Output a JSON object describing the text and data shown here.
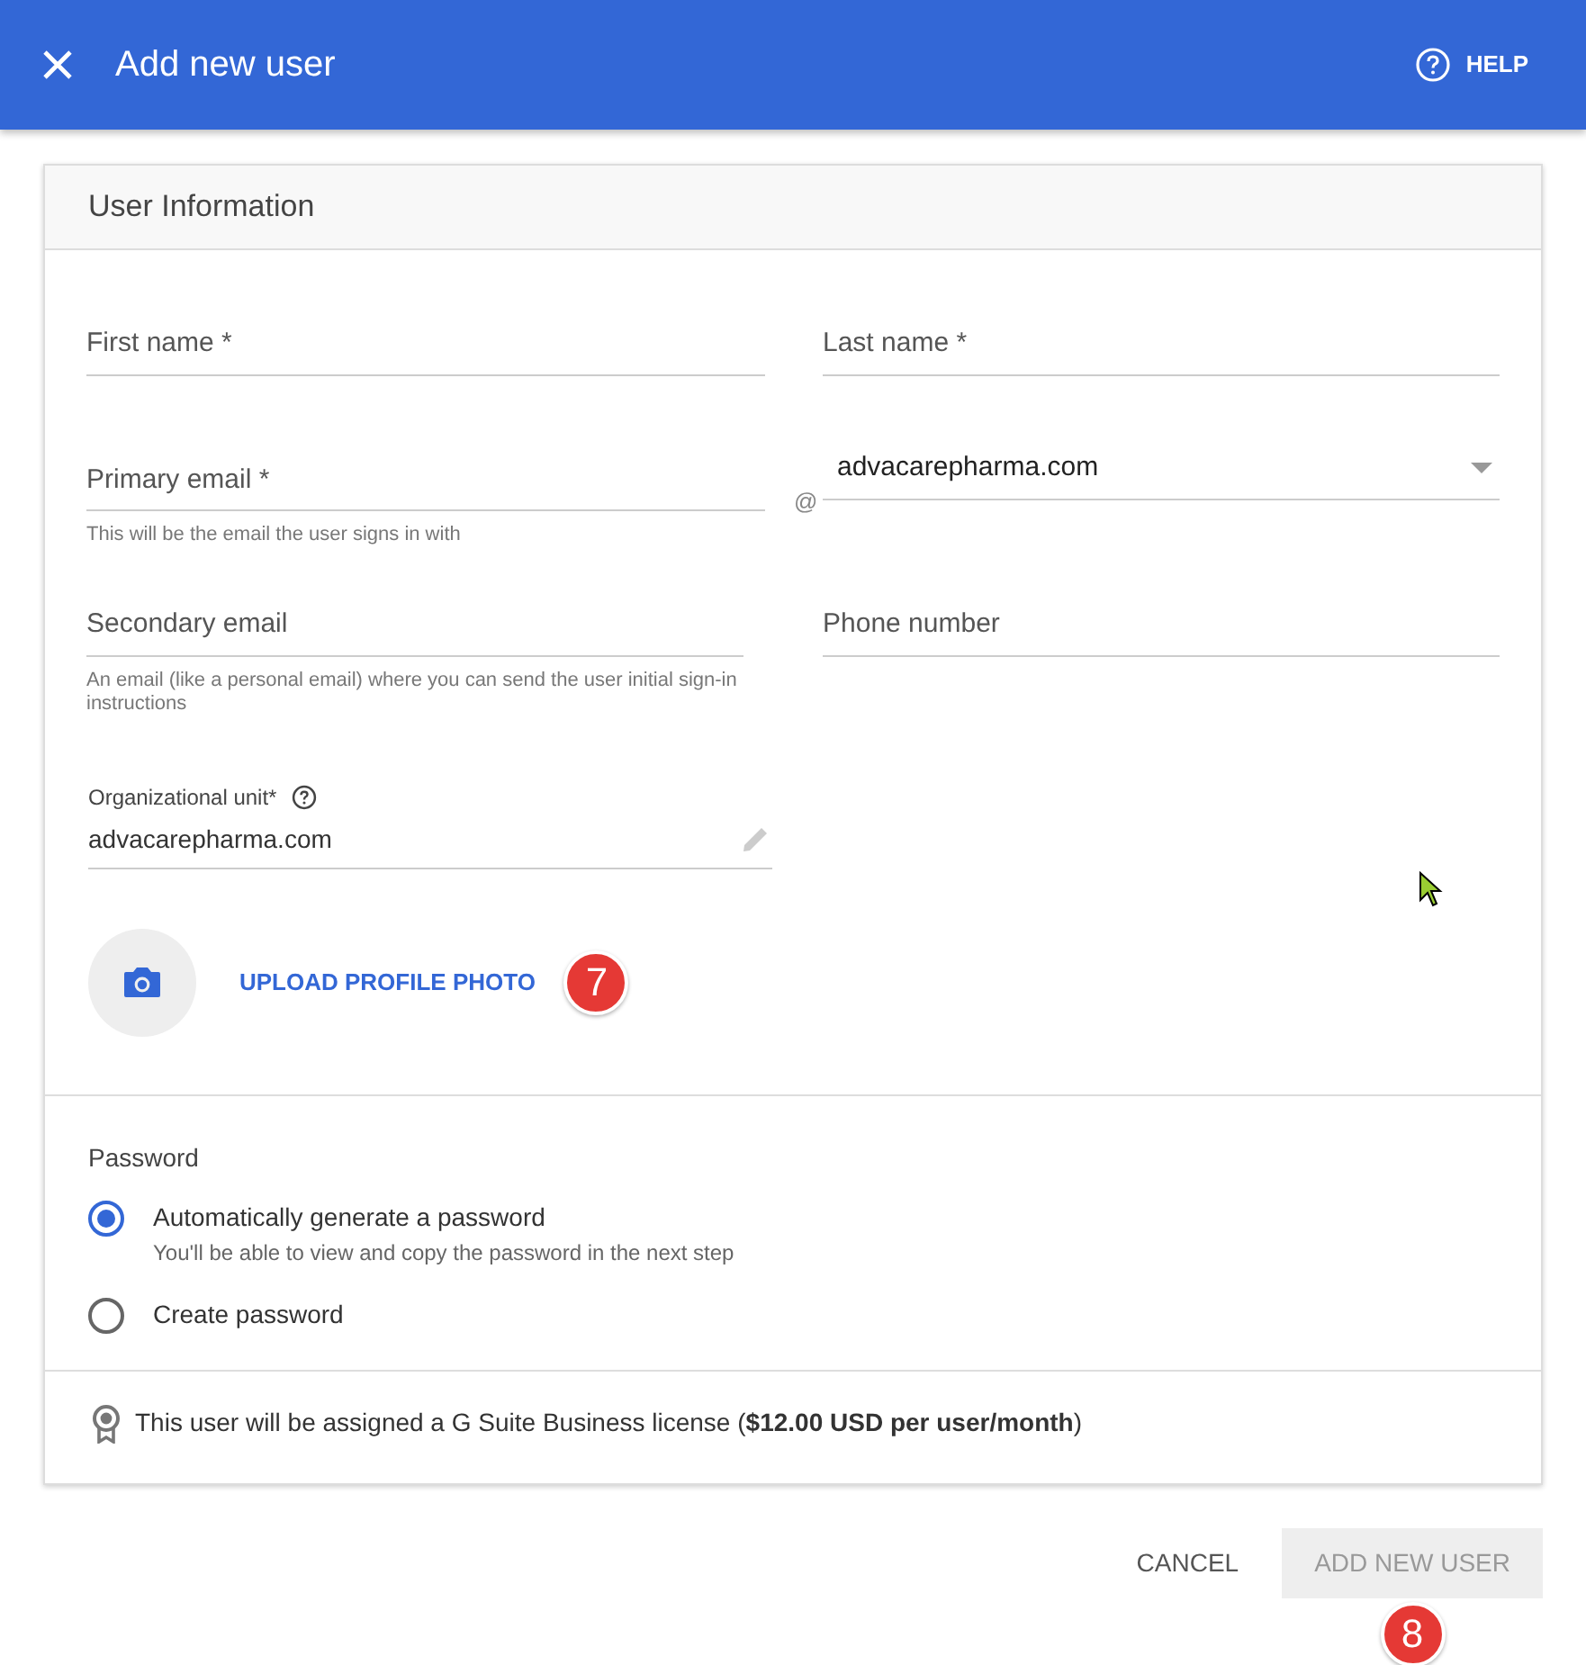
{
  "header": {
    "title": "Add new user",
    "help": "HELP"
  },
  "section": {
    "title": "User Information"
  },
  "first_name": {
    "placeholder": "First name *"
  },
  "last_name": {
    "placeholder": "Last name *"
  },
  "primary_email": {
    "placeholder": "Primary email *",
    "hint": "This will be the email the user signs in with"
  },
  "domain": {
    "at": "@",
    "value": "advacarepharma.com"
  },
  "secondary_email": {
    "placeholder": "Secondary email",
    "hint": "An email (like a personal email) where you can send the user initial sign-in instructions"
  },
  "phone": {
    "placeholder": "Phone number"
  },
  "org_unit": {
    "label": "Organizational unit*",
    "value": "advacarepharma.com"
  },
  "upload": {
    "label": "UPLOAD PROFILE PHOTO",
    "callout": "7"
  },
  "password": {
    "title": "Password",
    "options": [
      {
        "label": "Automatically generate a password",
        "hint": "You'll be able to view and copy the password in the next step",
        "selected": true
      },
      {
        "label": "Create password",
        "selected": false
      }
    ]
  },
  "license": "This user will be assigned a G Suite Business license (**$12.00 USD per user/month**)",
  "buttons": [
    {
      "label": "CANCEL",
      "kind": "text",
      "disabled": false
    },
    {
      "label": "ADD NEW USER",
      "kind": "filled",
      "disabled": true,
      "callout": "8"
    }
  ]
}
